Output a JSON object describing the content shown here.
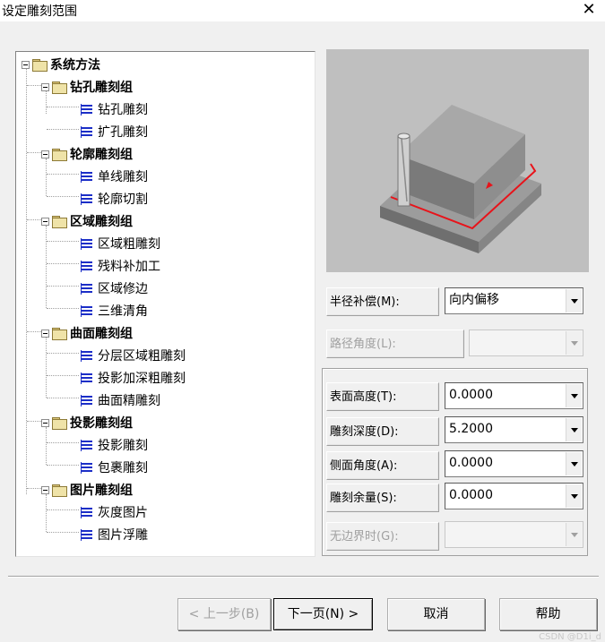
{
  "window": {
    "title": "设定雕刻范围",
    "close_glyph": "✕"
  },
  "tree": {
    "root": "系统方法",
    "groups": [
      {
        "label": "钻孔雕刻组",
        "items": [
          "钻孔雕刻",
          "扩孔雕刻"
        ]
      },
      {
        "label": "轮廓雕刻组",
        "items": [
          "单线雕刻",
          "轮廓切割"
        ]
      },
      {
        "label": "区域雕刻组",
        "items": [
          "区域粗雕刻",
          "残料补加工",
          "区域修边",
          "三维清角"
        ]
      },
      {
        "label": "曲面雕刻组",
        "items": [
          "分层区域粗雕刻",
          "投影加深粗雕刻",
          "曲面精雕刻"
        ]
      },
      {
        "label": "投影雕刻组",
        "items": [
          "投影雕刻",
          "包裹雕刻"
        ]
      },
      {
        "label": "图片雕刻组",
        "items": [
          "灰度图片",
          "图片浮雕"
        ]
      }
    ],
    "selected": "轮廓切割"
  },
  "params": {
    "radius_comp": {
      "label": "半径补偿(M):",
      "value": "向内偏移"
    },
    "path_angle": {
      "label": "路径角度(L):",
      "value": ""
    },
    "surface_height": {
      "label": "表面高度(T):",
      "value": "0.0000"
    },
    "carve_depth": {
      "label": "雕刻深度(D):",
      "value": "5.2000"
    },
    "side_angle": {
      "label": "侧面角度(A):",
      "value": "0.0000"
    },
    "carve_allowance": {
      "label": "雕刻余量(S):",
      "value": "0.0000"
    },
    "no_boundary": {
      "label": "无边界时(G):",
      "value": ""
    }
  },
  "buttons": {
    "prev": "< 上一步(B)",
    "next": "下一页(N) >",
    "cancel": "取消",
    "help": "帮助"
  },
  "watermark": "CSDN @D1i_d",
  "colors": {
    "path": "#e8131a",
    "block_top": "#9a9a9a",
    "base": "#8f8f8f"
  }
}
